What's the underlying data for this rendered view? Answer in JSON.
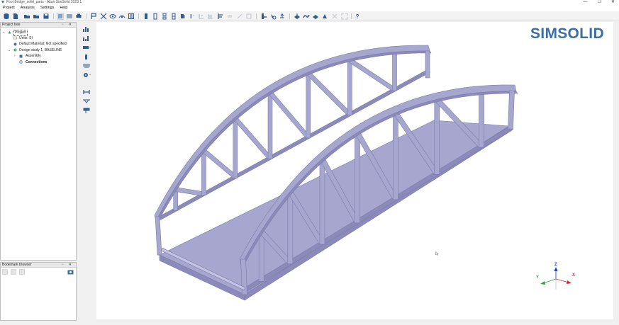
{
  "window": {
    "title": "Foot Bridge_solid_parts - Altair SimSolid 2023.1",
    "controls": [
      "—",
      "❐",
      "✕"
    ]
  },
  "menu": [
    "Project",
    "Analysis",
    "Settings",
    "Help"
  ],
  "toolbar": {
    "icons": [
      "database-icon",
      "new-project-icon",
      "open-folder-icon",
      "open-icon",
      "save-icon",
      "list-view-icon",
      "table-view-icon",
      "print-icon",
      "select-icon",
      "hide-icon",
      "show-icon",
      "view-icon",
      "clip-icon",
      "align-left-icon",
      "align-center-icon",
      "align-right-icon",
      "align-bottom-icon",
      "move-icon",
      "distribute-icon",
      "rotate-icon",
      "disabled-icon",
      "disabled-icon-2",
      "disabled-icon-3",
      "measure-icon",
      "probe-icon",
      "section-icon",
      "load-icon",
      "deform-icon",
      "result-icon",
      "contour-icon",
      "fit-disabled-icon",
      "zoom-disabled-icon",
      "help-icon"
    ],
    "help_label": "?"
  },
  "project_tree": {
    "title": "Project tree",
    "header_buttons": "▫ ✕",
    "items": [
      {
        "label": "Project",
        "level": 0,
        "expander": "⌄",
        "icon": "project-icon"
      },
      {
        "label": "Units: SI",
        "level": 1,
        "expander": "",
        "icon": "units-icon"
      },
      {
        "label": "Default Material: Not specified",
        "level": 1,
        "expander": "",
        "icon": "material-icon"
      },
      {
        "label": "Design study 1, BASELINE",
        "level": 1,
        "expander": "⌄",
        "icon": "design-study-icon"
      },
      {
        "label": "Assembly",
        "level": 2,
        "expander": "›",
        "icon": "assembly-icon"
      },
      {
        "label": "Connections",
        "level": 2,
        "expander": "",
        "icon": "connections-icon",
        "bold": true
      }
    ]
  },
  "bookmark_browser": {
    "title": "Bookmark browser",
    "header_buttons": "▫ ✕"
  },
  "viewport": {
    "brand": "SIMSOLID",
    "triad": {
      "z": "Z",
      "x": "X",
      "y": "Y"
    },
    "colors": {
      "bridge": "#a7a6cf",
      "bridge_dark": "#8b8ab8",
      "bridge_light": "#c4c3e3",
      "brand": "#3b6ea5"
    }
  }
}
